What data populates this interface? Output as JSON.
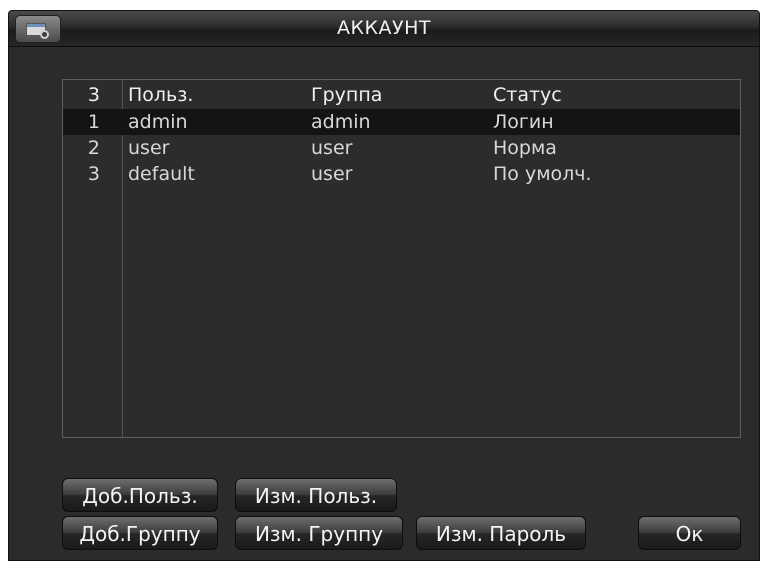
{
  "window": {
    "title": "АККАУНТ",
    "icon": "window-settings-icon"
  },
  "table": {
    "headers": {
      "count": "3",
      "user": "Польз.",
      "group": "Группа",
      "status": "Статус"
    },
    "rows": [
      {
        "index": "1",
        "user": "admin",
        "group": "admin",
        "status": "Логин",
        "selected": true
      },
      {
        "index": "2",
        "user": "user",
        "group": "user",
        "status": "Норма",
        "selected": false
      },
      {
        "index": "3",
        "user": "default",
        "group": "user",
        "status": "По умолч.",
        "selected": false
      }
    ]
  },
  "buttons": {
    "add_user": "Доб.Польз.",
    "edit_user": "Изм. Польз.",
    "add_group": "Доб.Группу",
    "edit_group": "Изм. Группу",
    "change_password": "Изм. Пароль",
    "ok": "Ок"
  },
  "colors": {
    "background": "#2b2b2b",
    "selected_row": "#141414",
    "text": "#d8d8d8"
  }
}
